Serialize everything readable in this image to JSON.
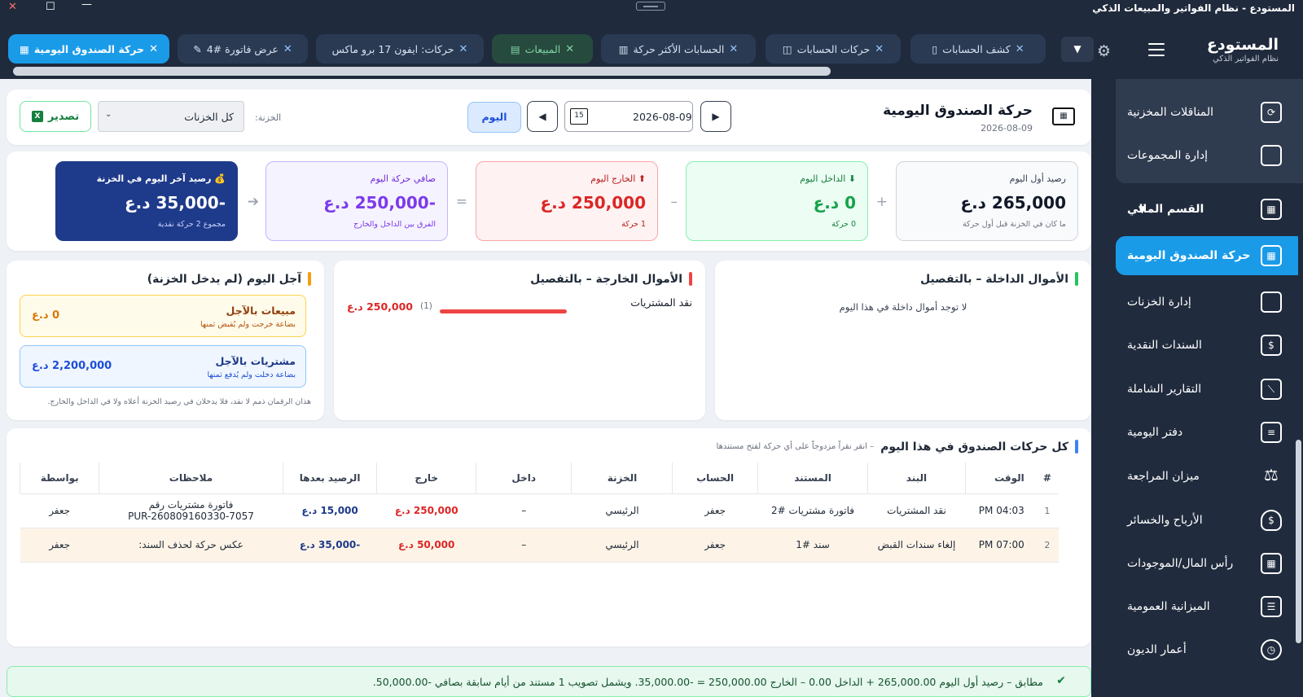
{
  "window": {
    "title": "المستودع - نظام الفواتير والمبيعات الذكي",
    "close": "✕",
    "maximize": "☐",
    "minimize": "—"
  },
  "brand": {
    "name": "المستودع",
    "subtitle": "نظام الفواتير الذكي"
  },
  "tabs": [
    {
      "label": "حركة الصندوق اليومية",
      "icon": "cash-register-icon",
      "active": true
    },
    {
      "label": "عرض فاتورة #4",
      "icon": "pencil-icon"
    },
    {
      "label": "حركات: ايفون 17 برو ماكس",
      "icon": ""
    },
    {
      "label": "المبيعات",
      "icon": "receipt-icon",
      "green": true
    },
    {
      "label": "الحسابات الأكثر حركة",
      "icon": "bar-chart-icon"
    },
    {
      "label": "حركات الحسابات",
      "icon": "accounts-icon"
    },
    {
      "label": "كشف الحسابات",
      "icon": "document-icon"
    }
  ],
  "tab_close": "✕",
  "sidebar": {
    "items": [
      {
        "label": "المناقلات المخزنية",
        "icon": "transfer-icon"
      },
      {
        "label": "إدارة المجموعات",
        "icon": "folder-icon"
      },
      {
        "label": "القسم المالي",
        "icon": "finance-icon",
        "section": true
      },
      {
        "label": "حركة الصندوق اليومية",
        "icon": "cash-register-icon",
        "active": true
      },
      {
        "label": "إدارة الخزنات",
        "icon": "briefcase-icon"
      },
      {
        "label": "السندات النقدية",
        "icon": "money-icon"
      },
      {
        "label": "التقارير الشاملة",
        "icon": "chart-line-icon"
      },
      {
        "label": "دفتر اليومية",
        "icon": "journal-icon"
      },
      {
        "label": "ميزان المراجعة",
        "icon": "scale-icon"
      },
      {
        "label": "الأرباح والخسائر",
        "icon": "money-bag-icon"
      },
      {
        "label": "رأس المال/الموجودات",
        "icon": "building-icon"
      },
      {
        "label": "الميزانية العمومية",
        "icon": "clipboard-icon"
      },
      {
        "label": "أعمار الديون",
        "icon": "clock-icon"
      }
    ]
  },
  "header": {
    "title": "حركة الصندوق اليومية",
    "date": "2026-08-09",
    "date_value": "2026-08-09",
    "calendar_day": "15",
    "today_label": "اليوم",
    "treasury_label": "الخزنة:",
    "treasury_value": "كل الخزنات",
    "export_label": "تصدير"
  },
  "stats": [
    {
      "title": "رصيد أول اليوم",
      "value": "265,000 د.ع",
      "sub": "ما كان في الخزنة قبل أول حركة"
    },
    {
      "title": "⬇ الداخل اليوم",
      "value": "0 د.ع",
      "sub": "0 حركة"
    },
    {
      "title": "⬆ الخارج اليوم",
      "value": "250,000 د.ع",
      "sub": "1 حركة"
    },
    {
      "title": "صافي حركة اليوم",
      "value": "-250,000 د.ع",
      "sub": "الفرق بين الداخل والخارج"
    },
    {
      "title": "💰 رصيد آخر اليوم في الخزنة",
      "value": "-35,000 د.ع",
      "sub": "مجموع 2 حركة نقدية"
    }
  ],
  "operators": {
    "plus": "+",
    "minus": "–",
    "equals": "=",
    "arrow": "➔"
  },
  "incoming": {
    "title": "الأموال الداخلة – بالتفصيل",
    "empty": "لا توجد أموال داخلة في هذا اليوم"
  },
  "outgoing": {
    "title": "الأموال الخارجة – بالتفصيل",
    "rows": [
      {
        "label": "نقد المشتريات",
        "count": "(1)",
        "amount": "250,000 د.ع",
        "share": 1.0
      }
    ]
  },
  "credit": {
    "title": "آجل اليوم (لم يدخل الخزنة)",
    "sales": {
      "label": "مبيعات بالآجل",
      "sub": "بضاعة خرجت ولم يُقبض ثمنها",
      "amount": "0 د.ع"
    },
    "purchases": {
      "label": "مشتريات بالآجل",
      "sub": "بضاعة دخلت ولم يُدفع ثمنها",
      "amount": "2,200,000 د.ع"
    },
    "note": "هذان الرقمان ذمم لا نقد، فلا يدخلان في رصيد الخزنة أعلاه ولا في الداخل والخارج."
  },
  "movements": {
    "title": "كل حركات الصندوق في هذا اليوم",
    "hint": "– انقر نقراً مزدوجاً على أي حركة لفتح مستندها",
    "columns": [
      "#",
      "الوقت",
      "البند",
      "المستند",
      "الحساب",
      "الخزنة",
      "داخل",
      "خارج",
      "الرصيد بعدها",
      "ملاحظات",
      "بواسطة"
    ],
    "rows": [
      {
        "n": "1",
        "time": "04:03 PM",
        "item": "نقد المشتريات",
        "doc": "فاتورة مشتريات #2",
        "account": "جعفر",
        "treasury": "الرئيسي",
        "in": "–",
        "out": "250,000 د.ع",
        "balance": "15,000 د.ع",
        "notes1": "فاتورة مشتريات رقم",
        "notes2": "PUR-260809160330-7057",
        "by": "جعفر"
      },
      {
        "n": "2",
        "time": "07:00 PM",
        "item": "إلغاء سندات القبض",
        "doc": "سند #1",
        "account": "جعفر",
        "treasury": "الرئيسي",
        "in": "–",
        "out": "50,000 د.ع",
        "balance": "-35,000 د.ع",
        "notes1": "عكس حركة لحذف السند:",
        "notes2": "",
        "by": "جعفر"
      }
    ]
  },
  "footer": {
    "check": "✔",
    "text": "مطابق – رصيد أول اليوم 265,000.00 + الداخل 0.00 – الخارج 250,000.00 = -35,000.00. ويشمل تصويب 1 مستند من أيام سابقة بصافي -50,000.00."
  },
  "colors": {
    "accent": "#1a9be8",
    "sidebar": "#202b3d",
    "topbar": "#1f2a3c",
    "positive": "#16a34a",
    "negative": "#dc2626",
    "net": "#7c3aed",
    "closing": "#1e3a8a"
  }
}
